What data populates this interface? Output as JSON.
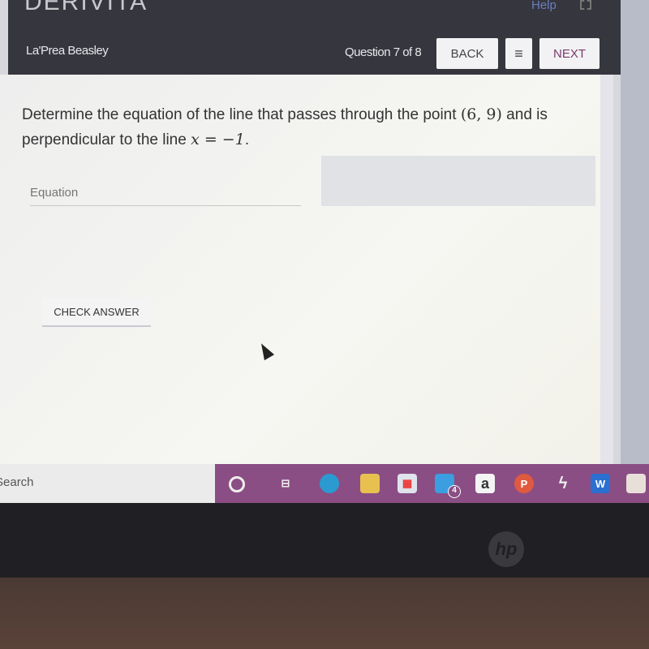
{
  "app": {
    "logo": "DERIVITA",
    "help": "Help"
  },
  "header": {
    "user": "La'Prea Beasley",
    "question_count": "Question 7 of 8",
    "back": "BACK",
    "menu_icon": "≡",
    "next": "NEXT"
  },
  "question": {
    "text_before": "Determine the equation of the line that passes through the point ",
    "point": "(6, 9)",
    "text_mid": " and is perpendicular to the line ",
    "line": "x = −1",
    "text_after": "."
  },
  "answer": {
    "placeholder": "Equation",
    "check": "CHECK ANSWER"
  },
  "taskbar": {
    "search": "Search",
    "mail_badge": "4",
    "icons": [
      "cortana-circle",
      "task-view",
      "edge",
      "file-explorer",
      "microsoft-store",
      "mail",
      "amazon",
      "powerpoint",
      "app-bolt",
      "word",
      "app-avatar"
    ]
  },
  "device": {
    "brand": "hp"
  }
}
